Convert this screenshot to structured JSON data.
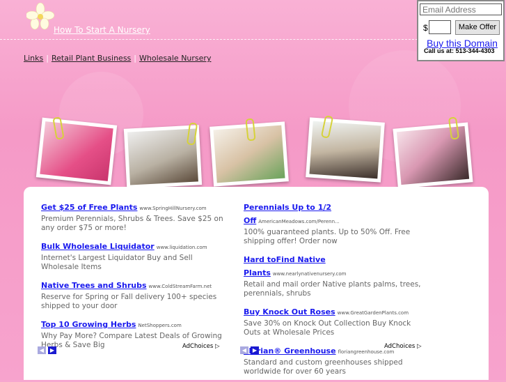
{
  "header": {
    "site_title": "How To Start A Nursery"
  },
  "nav": {
    "items": [
      "Links",
      "Retail Plant Business",
      "Wholesale Nursery"
    ]
  },
  "offer": {
    "email_placeholder": "Email Address",
    "currency": "$",
    "button_label": "Make Offer",
    "buy_link": "Buy this Domain",
    "call": "Call us at: 513-344-4303"
  },
  "ads_left": [
    {
      "title": "Get $25 of Free Plants",
      "url": "www.SpringHillNursery.com",
      "desc": "Premium Perennials, Shrubs & Trees. Save $25 on any order $75 or more!"
    },
    {
      "title": "Bulk Wholesale Liquidator",
      "url": "www.liquidation.com",
      "desc": "Internet's Largest Liquidator Buy and Sell Wholesale Items"
    },
    {
      "title": "Native Trees and Shrubs",
      "url": "www.ColdStreamFarm.net",
      "desc": "Reserve for Spring or Fall delivery 100+ species shipped to your door"
    },
    {
      "title": "Top 10 Growing Herbs",
      "url": "NetShoppers.com",
      "desc": "Why Pay More? Compare Latest Deals of Growing Herbs & Save Big"
    }
  ],
  "ads_right": [
    {
      "title": "Perennials Up to 1/2 Off",
      "url": "AmericanMeadows.com/Perenn...",
      "desc": "100% guaranteed plants. Up to 50% Off. Free shipping offer! Order now"
    },
    {
      "title": "Hard toFind Native Plants",
      "url": "www.nearlynativenursery.com",
      "desc": "Retail and mail order Native plants palms, trees, perennials, shrubs"
    },
    {
      "title": "Buy Knock Out Roses",
      "url": "www.GreatGardenPlants.com",
      "desc": "Save 30% on Knock Out Collection Buy Knock Outs at Wholesale Prices"
    },
    {
      "title": "Florian® Greenhouse",
      "url": "floriangreenhouse.com",
      "desc": "Standard and custom greenhouses shipped worldwide for over 60 years"
    }
  ],
  "adchoices": "AdChoices ▷"
}
